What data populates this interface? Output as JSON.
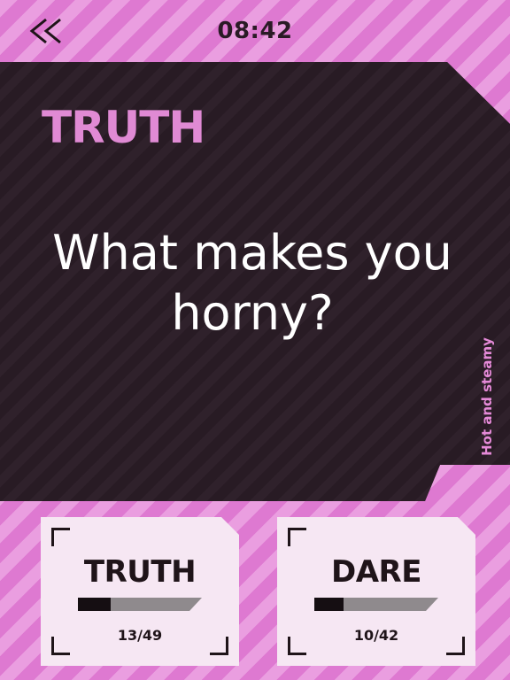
{
  "header": {
    "back_icon": "double-chevron-left-icon",
    "clock": "08:42"
  },
  "card": {
    "mode_title": "TRUTH",
    "question": "What makes you horny?",
    "category": "Hot and steamy"
  },
  "choices": [
    {
      "label": "TRUTH",
      "count": "13/49",
      "progress": 0.2653
    },
    {
      "label": "DARE",
      "count": "10/42",
      "progress": 0.2381
    }
  ],
  "colors": {
    "accent_pink": "#e58ad8",
    "card_dark": "#2b1e27",
    "choice_bg": "#f6e7f3",
    "text_dark": "#1f1419"
  }
}
